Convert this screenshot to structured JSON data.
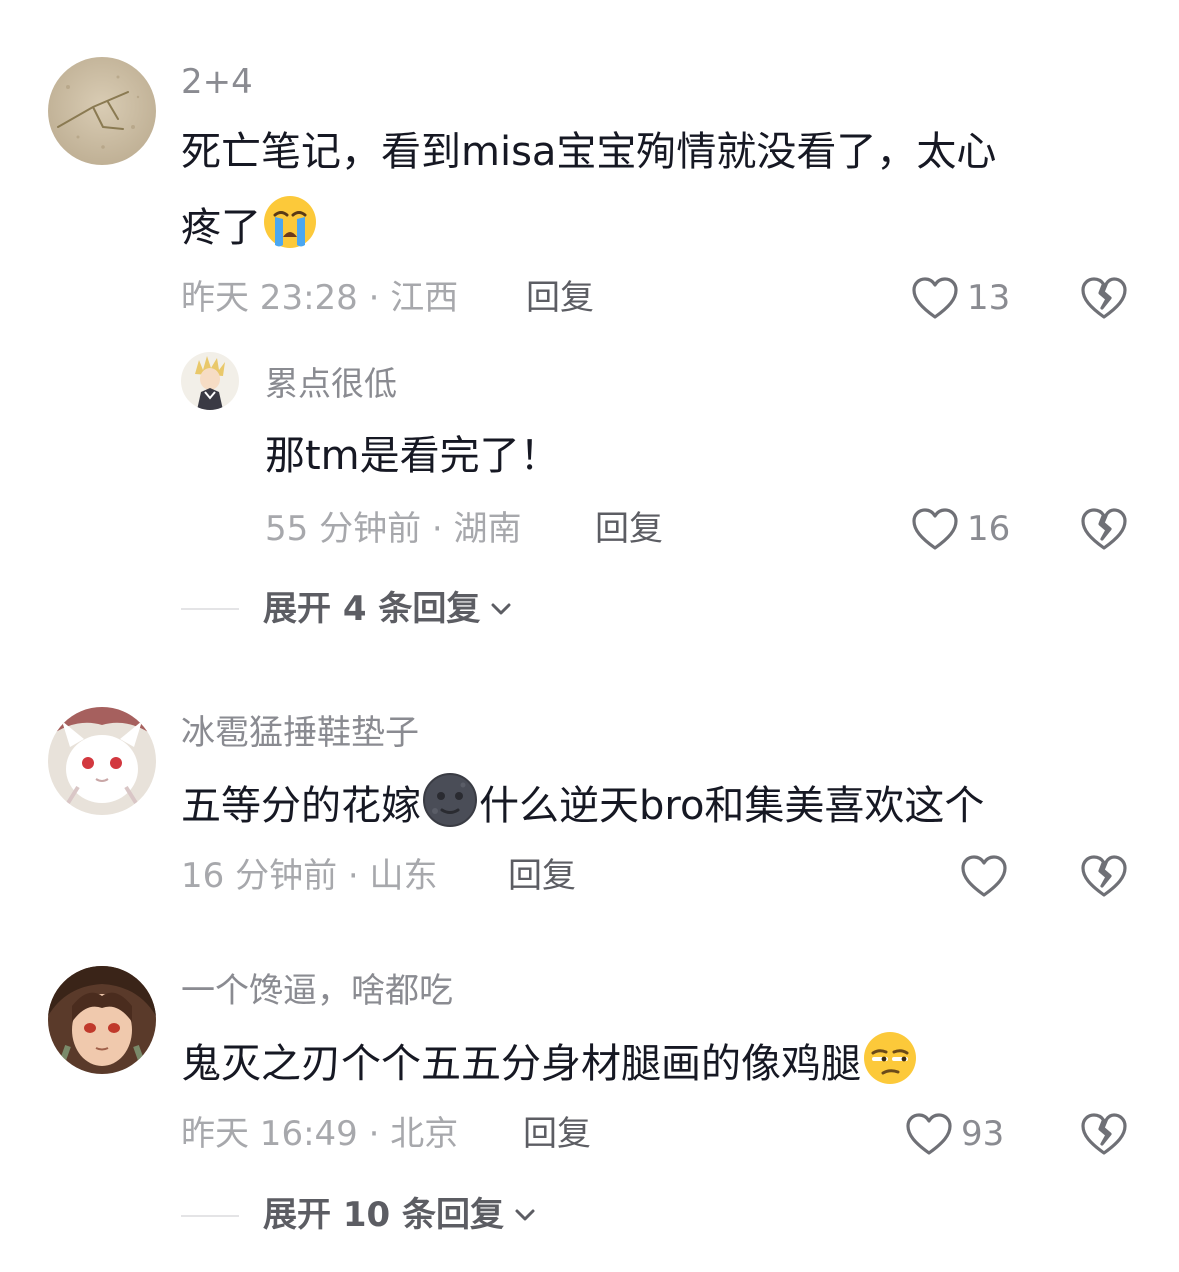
{
  "comments": [
    {
      "username": "2+4",
      "text_line1": "死亡笔记，看到misa宝宝殉情就没看了，太心",
      "text_line2": "疼了",
      "emoji": "loudly-crying-face",
      "time": "昨天 23:28",
      "location": "江西",
      "reply_label": "回复",
      "likes": "13",
      "replies": [
        {
          "username": "累点很低",
          "text": "那tm是看完了！",
          "time": "55 分钟前",
          "location": "湖南",
          "reply_label": "回复",
          "likes": "16"
        }
      ],
      "expand_label": "展开 4 条回复"
    },
    {
      "username": "冰雹猛捶鞋垫子",
      "text_before_emoji": "五等分的花嫁",
      "emoji": "new-moon-face",
      "text_after_emoji": "什么逆天bro和集美喜欢这个",
      "time": "16 分钟前",
      "location": "山东",
      "reply_label": "回复",
      "likes": ""
    },
    {
      "username": "一个馋逼，啥都吃",
      "text": "鬼灭之刃个个五五分身材腿画的像鸡腿",
      "emoji": "unamused-face",
      "time": "昨天 16:49",
      "location": "北京",
      "reply_label": "回复",
      "likes": "93",
      "expand_label": "展开 10 条回复"
    }
  ],
  "meta_separator": " · ",
  "colors": {
    "primary_text": "#161823",
    "username": "#8a8b91",
    "meta": "#a7a8ac",
    "action": "#5c5d63"
  }
}
